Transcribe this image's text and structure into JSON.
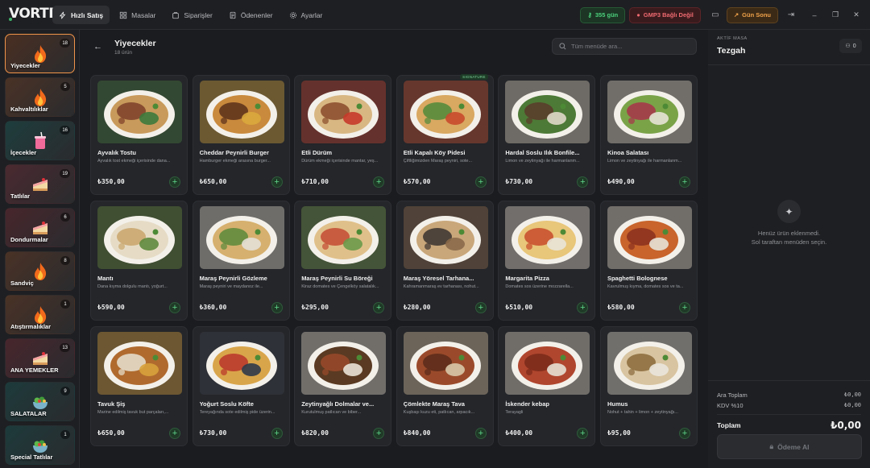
{
  "app": {
    "logo": "VORTE"
  },
  "nav": [
    {
      "label": "Hızlı Satış",
      "icon": "lightning-icon",
      "active": true
    },
    {
      "label": "Masalar",
      "icon": "grid-icon",
      "active": false
    },
    {
      "label": "Siparişler",
      "icon": "bag-icon",
      "active": false
    },
    {
      "label": "Ödenenler",
      "icon": "receipt-icon",
      "active": false
    },
    {
      "label": "Ayarlar",
      "icon": "gear-icon",
      "active": false
    }
  ],
  "topright": {
    "days": "355 gün",
    "gmp": "GMP3 Bağlı Değil",
    "day_end": "Gün Sonu"
  },
  "categories": [
    {
      "label": "Yiyecekler",
      "count": "18",
      "bg": "#4a2f22",
      "emoji": "fire",
      "active": true
    },
    {
      "label": "Kahvaltılıklar",
      "count": "5",
      "bg": "#4a3226",
      "emoji": "fire",
      "active": false
    },
    {
      "label": "İçecekler",
      "count": "16",
      "bg": "#1e3d3d",
      "emoji": "cup",
      "active": false
    },
    {
      "label": "Tatlılar",
      "count": "19",
      "bg": "#4a2a30",
      "emoji": "cake",
      "active": false
    },
    {
      "label": "Dondurmalar",
      "count": "6",
      "bg": "#47262c",
      "emoji": "cake",
      "active": false
    },
    {
      "label": "Sandviç",
      "count": "8",
      "bg": "#4a3226",
      "emoji": "fire",
      "active": false
    },
    {
      "label": "Atıştırmalıklar",
      "count": "1",
      "bg": "#4a3226",
      "emoji": "fire",
      "active": false
    },
    {
      "label": "ANA YEMEKLER",
      "count": "13",
      "bg": "#48262d",
      "emoji": "cake",
      "active": false
    },
    {
      "label": "SALATALAR",
      "count": "9",
      "bg": "#1d3a3b",
      "emoji": "salad",
      "active": false
    },
    {
      "label": "Special Tatlılar",
      "count": "1",
      "bg": "#1d3a3b",
      "emoji": "salad",
      "active": false
    }
  ],
  "section": {
    "title": "Yiyecekler",
    "subtitle": "18 ürün"
  },
  "search": {
    "placeholder": "Tüm menüde ara..."
  },
  "products": [
    {
      "name": "Ayvalık Tostu",
      "desc": "Ayvalık tost ekmeği içerisinde dana...",
      "price": "₺350,00",
      "c1": "#c89a5b",
      "c2": "#7d3f2a",
      "c3": "#3c7a3c"
    },
    {
      "name": "Cheddar Peynirli Burger",
      "desc": "Hamburger ekmeği arasına burger...",
      "price": "₺650,00",
      "c1": "#c98a3d",
      "c2": "#5a2f1a",
      "c3": "#d9a93c"
    },
    {
      "name": "Etli Dürüm",
      "desc": "Dürüm ekmeği içerisinde mantar, yeş...",
      "price": "₺710,00",
      "c1": "#d8b783",
      "c2": "#8a4a2a",
      "c3": "#c73a2a"
    },
    {
      "name": "Etli Kapalı Köy Pidesi",
      "desc": "Çiftliğimizden Maraş peyniri, sote...",
      "price": "₺570,00",
      "c1": "#d9a861",
      "c2": "#4f8a3a",
      "c3": "#c84a2c",
      "badge": "SIGNATURE"
    },
    {
      "name": "Hardal Soslu Ilık Bonfile...",
      "desc": "Limon ve zeytinyağı ile harmanlanm...",
      "price": "₺730,00",
      "c1": "#4d7a36",
      "c2": "#5b3a2a",
      "c3": "#e0d8c8"
    },
    {
      "name": "Kinoa Salatası",
      "desc": "Limon ve zeytinyağı ile harmanlanm...",
      "price": "₺490,00",
      "c1": "#7aa348",
      "c2": "#a8344a",
      "c3": "#e7e3d5"
    },
    {
      "name": "Mantı",
      "desc": "Dana kıyma dolgulu mantı, yoğurt...",
      "price": "₺590,00",
      "c1": "#e6dcc6",
      "c2": "#c9a56b",
      "c3": "#5f8a3d"
    },
    {
      "name": "Maraş Peynirli Gözleme",
      "desc": "Maraş peyniri ve maydanoz ile...",
      "price": "₺360,00",
      "c1": "#d6b06e",
      "c2": "#5b8a3a",
      "c3": "#e4e0d6"
    },
    {
      "name": "Maraş Peynirli Su Böreği",
      "desc": "Kiraz domates ve Çengelköy salatalık...",
      "price": "₺295,00",
      "c1": "#e0c08a",
      "c2": "#c34a32",
      "c3": "#6b9a4a"
    },
    {
      "name": "Maraş Yöresel Tarhana...",
      "desc": "Kahramanmaraş ev tarhanası, nohut...",
      "price": "₺280,00",
      "c1": "#c9a77a",
      "c2": "#3a3230",
      "c3": "#8a6a4a"
    },
    {
      "name": "Margarita Pizza",
      "desc": "Domates sos üzerine mozzarella...",
      "price": "₺510,00",
      "c1": "#e8c67a",
      "c2": "#c74a2a",
      "c3": "#e9e4d8"
    },
    {
      "name": "Spaghetti Bolognese",
      "desc": "Kavrulmuş kıyma, domates sos ve ta...",
      "price": "₺580,00",
      "c1": "#c8642c",
      "c2": "#8a2f1e",
      "c3": "#e7e2d6"
    },
    {
      "name": "Tavuk Şiş",
      "desc": "Marine edilmiş tavuk but parçaları,...",
      "price": "₺650,00",
      "c1": "#b06a2e",
      "c2": "#e8e2d2",
      "c3": "#d8a23c"
    },
    {
      "name": "Yoğurt Soslu Köfte",
      "desc": "Tereyağında sote edilmiş pide üzerin...",
      "price": "₺730,00",
      "c1": "#d9a54a",
      "c2": "#b8342a",
      "c3": "#2f3a4a"
    },
    {
      "name": "Zeytinyağlı Dolmalar ve...",
      "desc": "Kurutulmuş patlıcan ve biber...",
      "price": "₺820,00",
      "c1": "#5a3a22",
      "c2": "#9a4a2a",
      "c3": "#e9e3d7"
    },
    {
      "name": "Çömlekte Maraş Tava",
      "desc": "Kuşbaşı kuzu eti, patlıcan, arpacık...",
      "price": "₺840,00",
      "c1": "#9a4a2a",
      "c2": "#5a2a1a",
      "c3": "#d8c6a8"
    },
    {
      "name": "İskender kebap",
      "desc": "Terayagli",
      "price": "₺400,00",
      "c1": "#b0462e",
      "c2": "#7a2a1a",
      "c3": "#e6e0d4"
    },
    {
      "name": "Humus",
      "desc": "Nohut + tahin + limon + zeytinyağı...",
      "price": "₺95,00",
      "c1": "#d8c4a0",
      "c2": "#8a6a3a",
      "c3": "#eae6dc"
    }
  ],
  "right": {
    "label": "AKTİF MASA",
    "title": "Tezgah",
    "user_count": "0",
    "empty_line1": "Henüz ürün eklenmedi.",
    "empty_line2": "Sol taraftan menüden seçin.",
    "subtotal_label": "Ara Toplam",
    "subtotal_value": "₺0,00",
    "vat_label": "KDV %10",
    "vat_value": "₺0,00",
    "total_label": "Toplam",
    "total_value": "₺0,00",
    "pay_label": "Ödeme Al"
  },
  "colors": {
    "accent": "#f0944a",
    "success": "#4bd17c",
    "danger": "#ee6a70",
    "warning": "#f0a24a"
  }
}
